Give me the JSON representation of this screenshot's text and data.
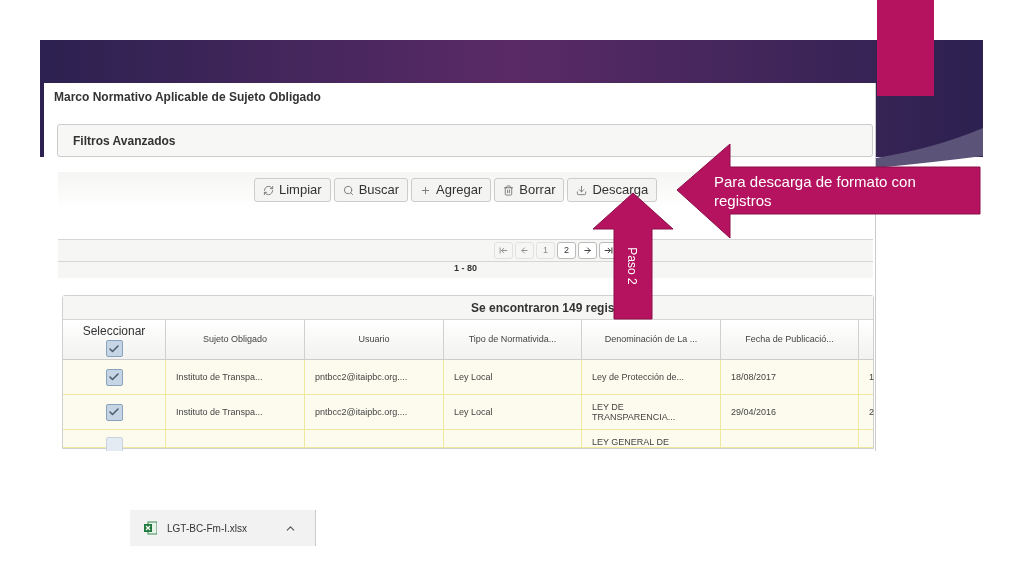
{
  "screen": {
    "title": "Marco Normativo Aplicable de Sujeto Obligado",
    "filters_panel": {
      "label": "Filtros Avanzados"
    },
    "toolbar": [
      {
        "label": "Limpiar",
        "kind": "refresh"
      },
      {
        "label": "Buscar",
        "kind": "search"
      },
      {
        "label": "Agregar",
        "kind": "add"
      },
      {
        "label": "Borrar",
        "kind": "delete"
      },
      {
        "label": "Descarga",
        "kind": "download"
      }
    ],
    "pager": {
      "controls": [
        {
          "kind": "first",
          "disabled": true
        },
        {
          "kind": "prev",
          "disabled": true
        },
        {
          "kind": "page",
          "label": "1",
          "disabled": true
        },
        {
          "kind": "page",
          "label": "2",
          "disabled": false
        },
        {
          "kind": "next",
          "disabled": false
        },
        {
          "kind": "last",
          "disabled": false
        }
      ],
      "range": "1 - 80"
    },
    "results": {
      "summary": "Se encontraron 149 regis",
      "select_column": {
        "label": "Seleccionar",
        "checked": true
      },
      "columns": [
        "Sujeto Obligado",
        "Usuario",
        "Tipo de Normativida...",
        "Denominación de La ...",
        "Fecha de Publicació..."
      ],
      "rows": [
        {
          "checked": true,
          "cells": [
            "Instituto de Transpa...",
            "pntbcc2@itaipbc.org....",
            "Ley Local",
            "Ley de Protección de...",
            "18/08/2017",
            "1"
          ]
        },
        {
          "checked": true,
          "cells": [
            "Instituto de Transpa...",
            "pntbcc2@itaipbc.org....",
            "Ley Local",
            "LEY DE TRANSPARENCIA...",
            "29/04/2016",
            "2"
          ]
        },
        {
          "checked": false,
          "cells": [
            "",
            "",
            "",
            "LEY GENERAL DE",
            "",
            ""
          ]
        }
      ]
    }
  },
  "callouts": [
    {
      "kind": "left",
      "text": "Para descarga de formato con registros"
    },
    {
      "kind": "up",
      "text": "Paso 2"
    }
  ],
  "download_bar": {
    "file_name": "LGT-BC-Fm-I.xlsx"
  }
}
